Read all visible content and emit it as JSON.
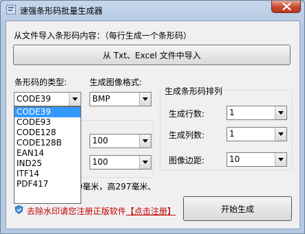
{
  "window": {
    "title": "速强条形码批量生成器",
    "close_icon": "close-icon"
  },
  "import_section": {
    "label": "从文件导入条形码内容：（每行生成一个条形码）",
    "button_label": "从 Txt、Excel 文件中导入"
  },
  "barcode_type": {
    "label": "条形码的类型:",
    "selected": "CODE39",
    "options": [
      "CODE39",
      "CODE93",
      "CODE128",
      "CODE128B",
      "EAN14",
      "IND25",
      "ITF14",
      "PDF417"
    ]
  },
  "image_format": {
    "label": "生成图像格式:",
    "selected": "BMP"
  },
  "size_group": {
    "width_value": "100",
    "height_value": "100"
  },
  "layout_group": {
    "legend": "生成条形码排列",
    "rows_label": "生成行数:",
    "rows_value": "1",
    "cols_label": "生成列数:",
    "cols_value": "1",
    "margin_label": "图像边距:",
    "margin_value": "10"
  },
  "note": "注：A4纸张宽210毫米，高297毫米、",
  "register": {
    "icon": "shield-icon",
    "text": "去除水印请您注册正版软件",
    "link_text": "【点击注册】"
  },
  "start_button": {
    "label": "开始生成"
  },
  "colors": {
    "titlebar": "#c5d6ec",
    "close_button": "#c7472f",
    "selection": "#3399ff",
    "register_text": "#c00000"
  }
}
